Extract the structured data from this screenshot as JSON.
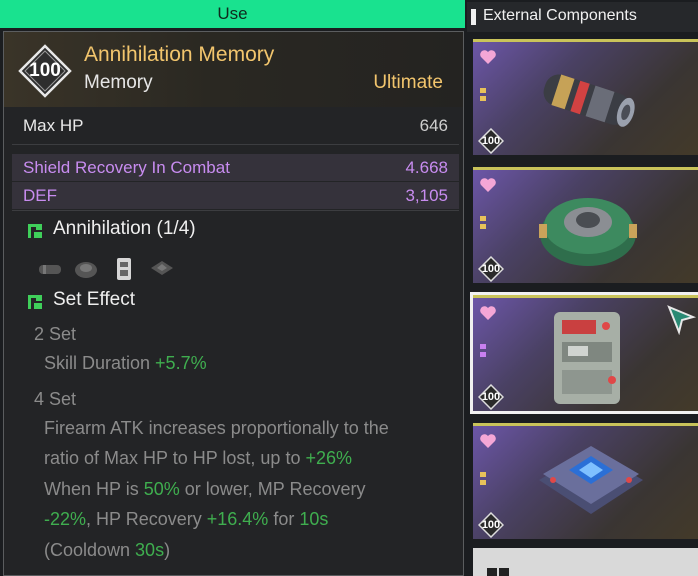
{
  "top_bar": {
    "label": "Use"
  },
  "item": {
    "level": "100",
    "name": "Annihilation Memory",
    "category": "Memory",
    "tier": "Ultimate",
    "main_stat": {
      "label": "Max HP",
      "value": "646"
    },
    "sub_stats": [
      {
        "label": "Shield Recovery In Combat",
        "value": "4.668"
      },
      {
        "label": "DEF",
        "value": "3,105"
      }
    ],
    "set": {
      "title": "Annihilation (1/4)"
    },
    "set_effect": {
      "title": "Set Effect",
      "two_set": {
        "label": "2 Set",
        "text": "Skill Duration ",
        "value": "+5.7%"
      },
      "four_set": {
        "label": "4 Set",
        "line1": "Firearm ATK increases proportionally to the",
        "line2_a": "ratio of Max HP to HP lost, up to ",
        "line2_v": "+26%",
        "line3_a": "When HP is ",
        "line3_v": "50%",
        "line3_b": " or lower, MP Recovery",
        "line4_v1": "-22%",
        "line4_a": ", HP Recovery ",
        "line4_v2": "+16.4%",
        "line4_b": " for ",
        "line4_v3": "10s",
        "line5_a": "(Cooldown ",
        "line5_v": "30s",
        "line5_b": ")"
      }
    },
    "colors": {
      "gold": "#f2c56d",
      "purple": "#c88cf0",
      "green": "#3fae4f",
      "accent": "#19e28f"
    }
  },
  "list": {
    "header": "External Components",
    "cards": [
      {
        "level": "100",
        "icon": "cylinder-component-icon"
      },
      {
        "level": "100",
        "icon": "round-core-component-icon"
      },
      {
        "level": "100",
        "icon": "battery-pack-component-icon"
      },
      {
        "level": "100",
        "icon": "chip-module-component-icon"
      }
    ]
  }
}
